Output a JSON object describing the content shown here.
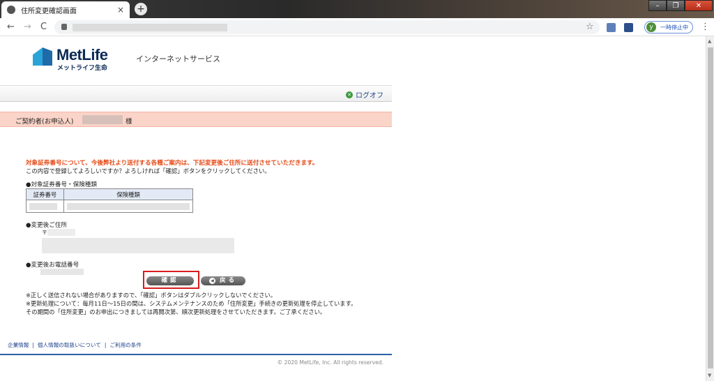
{
  "browser": {
    "tab_title": "住所変更確認画面",
    "tab_close": "×",
    "new_tab": "+",
    "back": "←",
    "forward": "→",
    "reload": "C",
    "star": "☆",
    "profile_initial": "y",
    "profile_label": "一時停止中",
    "menu": "⋮",
    "win_min": "–",
    "win_max": "❐",
    "win_close": "✕"
  },
  "header": {
    "brand": "MetLife",
    "brand_sub": "メットライフ生命",
    "service": "インターネットサービス",
    "logoff": "ログオフ"
  },
  "contract": {
    "label": "ご契約者(お申込人)",
    "suffix": "様"
  },
  "messages": {
    "notice_red": "対象証券番号について、今後弊社より送付する各種ご案内は、下記変更後ご住所に送付させていただきます。",
    "notice_black": "この内容で登録してよろしいですか？よろしければ「確認」ボタンをクリックしてください。"
  },
  "sections": {
    "policy": "●対象証券番号・保険種類",
    "address": "●変更後ご住所",
    "zip_mark": "〒",
    "phone": "●変更後お電話番号"
  },
  "table": {
    "headers": [
      "証券番号",
      "保険種類"
    ]
  },
  "buttons": {
    "confirm": "確認",
    "back": "戻る",
    "back_arrow": "◀"
  },
  "notes": [
    "※正しく送信されない場合がありますので、「確認」ボタンはダブルクリックしないでください。",
    "※更新処理について：毎月11日～15日の間は、システムメンテナンスのため「住所変更」手続きの更新処理を停止しています。",
    "その期間の「住所変更」のお申出につきましては再開次第、順次更新処理をさせていただきます。ご了承ください。"
  ],
  "footer": {
    "links": [
      "企業情報",
      "個人情報の取扱いについて",
      "ご利用の条件"
    ],
    "separator": "|",
    "copyright": "© 2020 MetLife, Inc. All rights reserved."
  },
  "colors": {
    "notice_red": "#e64a17",
    "contract_bar": "#fad4c8",
    "highlight_border": "#d81b1b",
    "link_blue": "#1a3f8a"
  }
}
